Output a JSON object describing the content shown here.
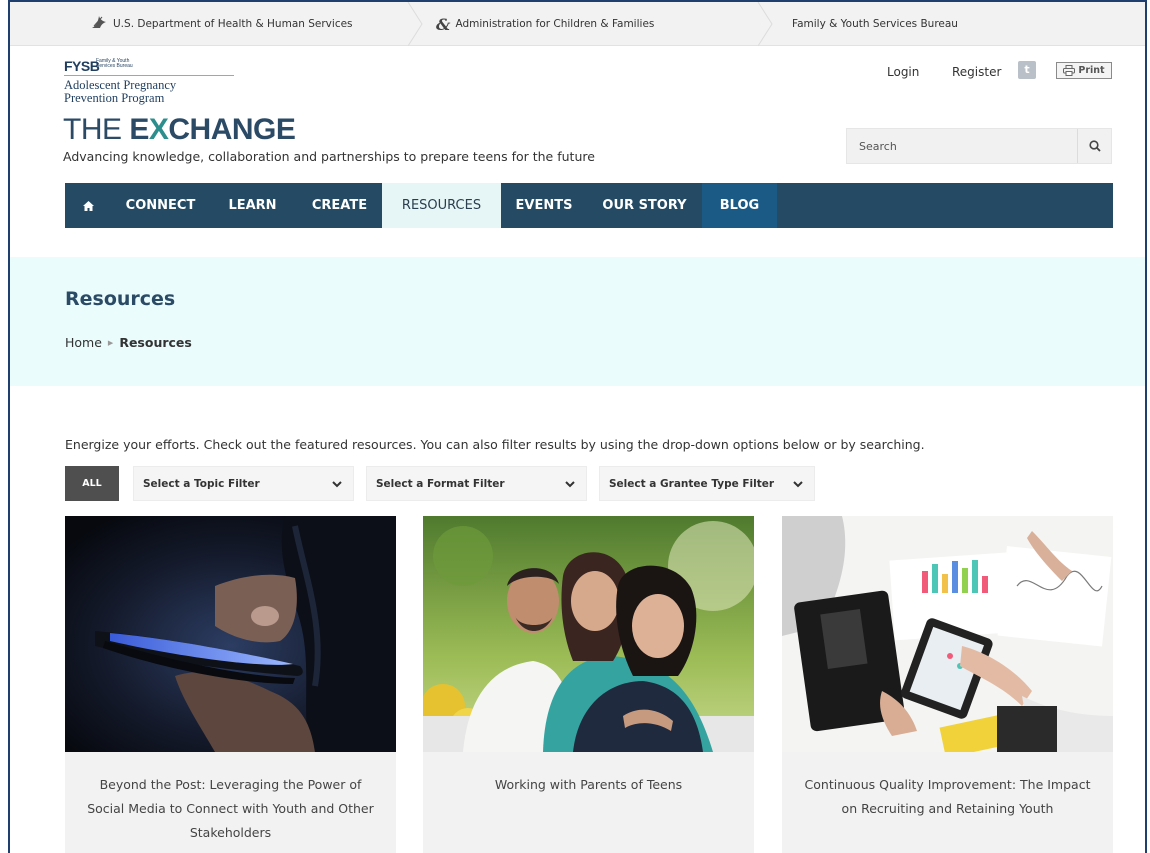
{
  "agency_bar": {
    "hhs": "U.S. Department of Health & Human Services",
    "acf": "Administration for Children & Families",
    "fysb": "Family & Youth Services Bureau"
  },
  "logo": {
    "mark": "FYSB",
    "mark_sub": "Family & Youth Services Bureau",
    "program_line1": "Adolescent Pregnancy",
    "program_line2": "Prevention Program",
    "title_the": "THE ",
    "title_e": "E",
    "title_x": "X",
    "title_rest": "CHANGE",
    "tagline": "Advancing knowledge, collaboration and partnerships to prepare teens for the future"
  },
  "utility": {
    "login": "Login",
    "register": "Register",
    "twitter_glyph": "t",
    "print": "Print"
  },
  "search": {
    "placeholder": "Search"
  },
  "nav": {
    "home_icon": "home-icon",
    "items": [
      "CONNECT",
      "LEARN",
      "CREATE",
      "RESOURCES",
      "EVENTS",
      "OUR STORY",
      "BLOG"
    ],
    "active": "RESOURCES"
  },
  "hero": {
    "title": "Resources",
    "breadcrumb": [
      "Home",
      "Resources"
    ]
  },
  "intro": "Energize your efforts. Check out the featured resources. You can also filter results by using the drop-down options below or by searching.",
  "filters": {
    "all": "ALL",
    "topic": "Select a Topic Filter",
    "format": "Select a Format Filter",
    "grantee": "Select a Grantee Type Filter"
  },
  "cards": [
    {
      "title": "Beyond the Post: Leveraging the Power of Social Media to Connect with Youth and Other Stakeholders",
      "image": "phone-in-hand-photo"
    },
    {
      "title": "Working with Parents of Teens",
      "image": "family-portrait-photo"
    },
    {
      "title": "Continuous Quality Improvement: The Impact on Recruiting and Retaining Youth",
      "image": "desk-meeting-photo"
    }
  ],
  "colors": {
    "nav_bg": "#244a64",
    "nav_active_bg": "#e6f6f6",
    "blog_bg": "#1c5a86",
    "band_bg": "#eafcfc",
    "accent_teal": "#2d8e8e"
  }
}
